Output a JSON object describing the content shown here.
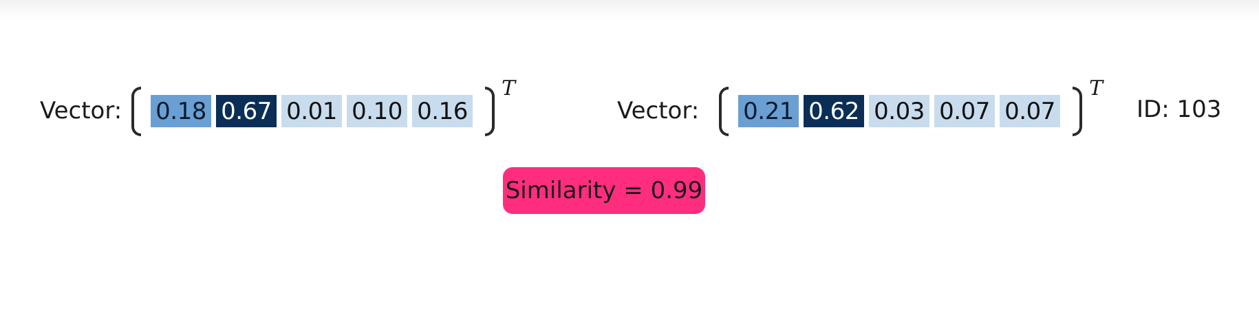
{
  "vector_a": {
    "label": "Vector:",
    "transpose": "T",
    "values": [
      {
        "text": "0.18",
        "bg": "#6a9fd4",
        "fg": "#0d1a2b"
      },
      {
        "text": "0.67",
        "bg": "#0b2e57",
        "fg": "#ffffff"
      },
      {
        "text": "0.01",
        "bg": "#c8dcee",
        "fg": "#111111"
      },
      {
        "text": "0.10",
        "bg": "#c8dcee",
        "fg": "#111111"
      },
      {
        "text": "0.16",
        "bg": "#c8dcee",
        "fg": "#111111"
      }
    ]
  },
  "vector_b": {
    "label": "Vector:",
    "transpose": "T",
    "id_label": "ID: 103",
    "values": [
      {
        "text": "0.21",
        "bg": "#6a9fd4",
        "fg": "#0d1a2b"
      },
      {
        "text": "0.62",
        "bg": "#0b2e57",
        "fg": "#ffffff"
      },
      {
        "text": "0.03",
        "bg": "#c8dcee",
        "fg": "#111111"
      },
      {
        "text": "0.07",
        "bg": "#c8dcee",
        "fg": "#111111"
      },
      {
        "text": "0.07",
        "bg": "#c8dcee",
        "fg": "#111111"
      }
    ]
  },
  "similarity": {
    "text": "Similarity = 0.99",
    "bg": "#ff2d7e",
    "fg": "#1a1a1a"
  }
}
